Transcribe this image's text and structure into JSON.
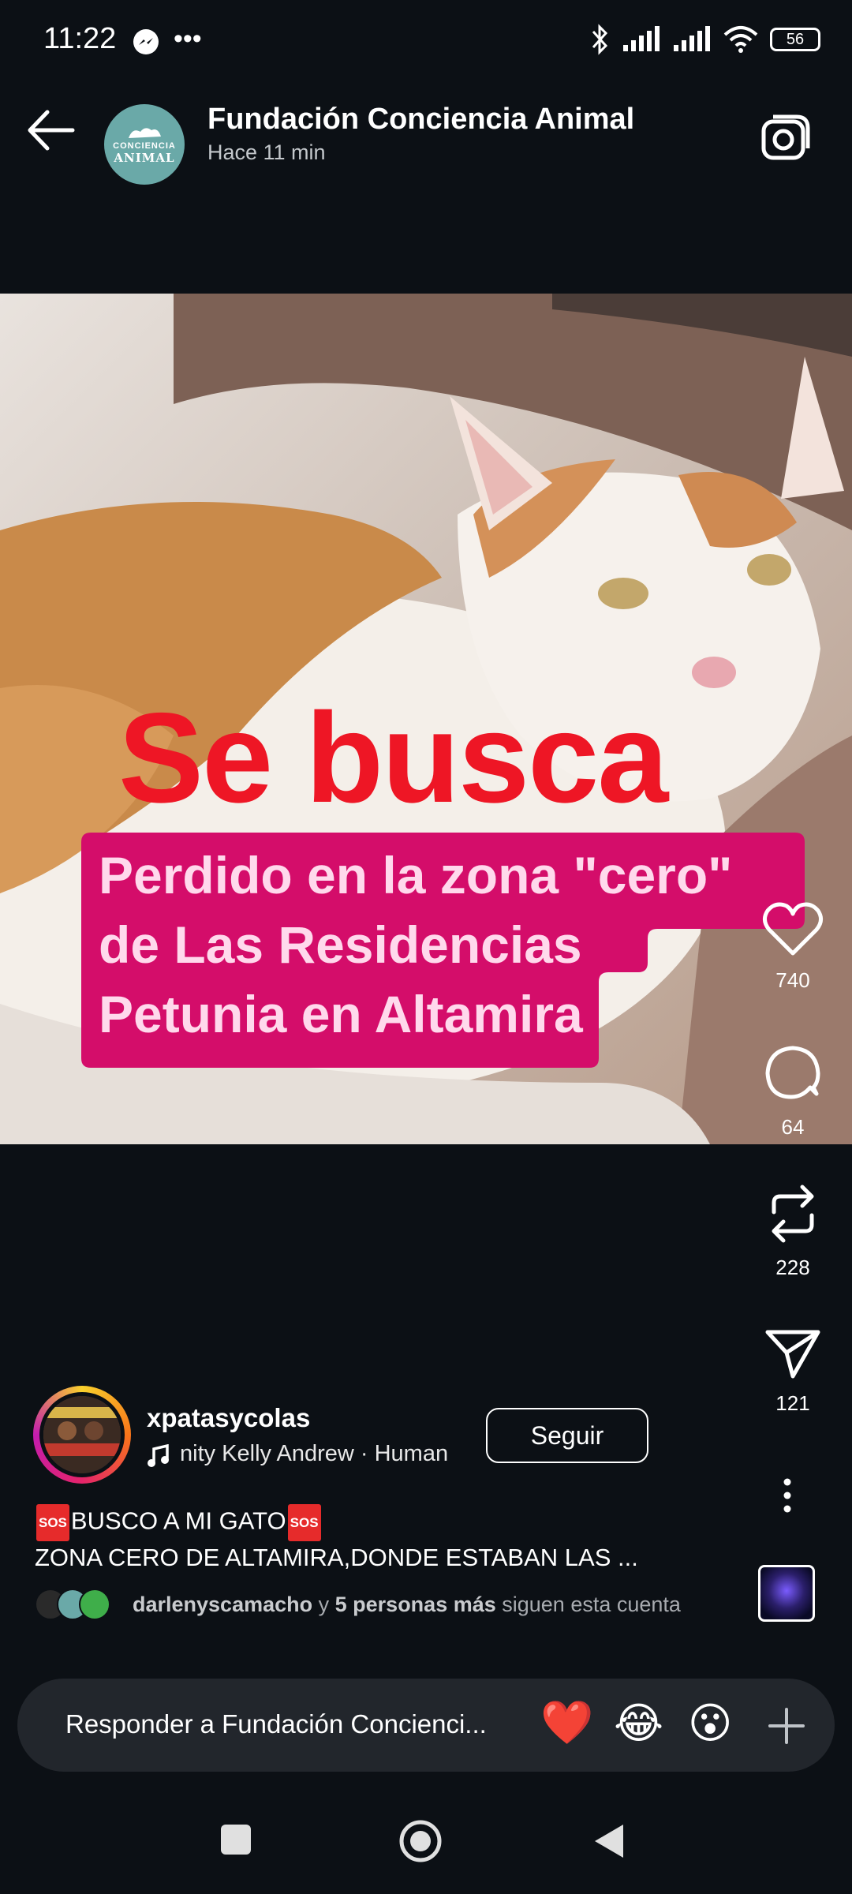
{
  "status_bar": {
    "time": "11:22",
    "battery": "56"
  },
  "header": {
    "back_icon": "arrow-left-icon",
    "account_name": "Fundación Conciencia Animal",
    "timestamp": "Hace 11 min",
    "avatar_text_1": "CONCIENCIA",
    "avatar_text_2": "ANIMAL",
    "camera_icon": "camera-icon"
  },
  "story": {
    "headline": "Se busca",
    "subtext_lines": [
      "Perdido en la zona \"cero\"",
      "de Las Residencias",
      "Petunia en Altamira"
    ],
    "colors": {
      "headline": "#ee1625",
      "box": "#d40d6a",
      "box_text": "#ffd9ec"
    }
  },
  "actions": {
    "likes": "740",
    "comments": "64",
    "reposts": "228",
    "shares": "121"
  },
  "post_info": {
    "username": "xpatasycolas",
    "music_text": "nity    Kelly Andrew · Human",
    "follow_label": "Seguir",
    "caption_line1_text": "BUSCO A MI GATO",
    "sos_badge": "SOS",
    "caption_line2": "ZONA CERO DE ALTAMIRA,DONDE ESTABAN LAS ...",
    "followers_user": "darlenyscamacho",
    "followers_join": " y ",
    "followers_count": "5 personas más",
    "followers_suffix": " siguen esta cuenta"
  },
  "reply_bar": {
    "placeholder": "Responder a Fundación Concienci...",
    "emojis": [
      "❤️",
      "😂",
      "😮"
    ]
  }
}
